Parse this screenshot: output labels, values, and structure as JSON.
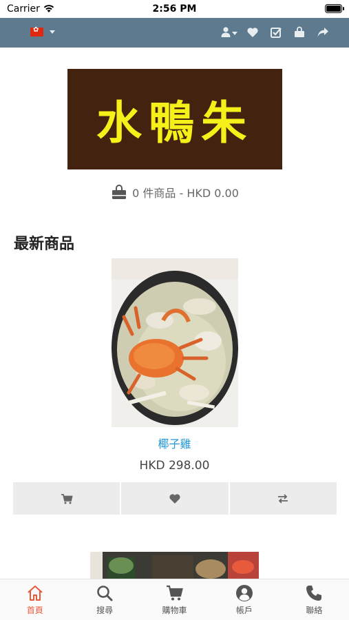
{
  "status_bar": {
    "carrier": "Carrier",
    "time": "2:56 PM"
  },
  "top_bar": {
    "language_flag": "hong-kong-flag-icon",
    "icons": [
      "user-icon",
      "heart-icon",
      "checklist-icon",
      "shopping-bag-icon",
      "share-icon"
    ]
  },
  "logo": {
    "text": "水鴨朱"
  },
  "cart": {
    "summary": "0 件商品 - HKD 0.00"
  },
  "latest": {
    "title": "最新商品",
    "product": {
      "name": "椰子雞",
      "price": "HKD 298.00"
    },
    "actions": [
      "add-to-cart-icon",
      "wishlist-heart-icon",
      "compare-icon"
    ]
  },
  "bottom_nav": {
    "items": [
      {
        "label": "首頁",
        "icon": "home-icon",
        "active": true
      },
      {
        "label": "搜尋",
        "icon": "search-icon",
        "active": false
      },
      {
        "label": "購物車",
        "icon": "cart-icon",
        "active": false
      },
      {
        "label": "帳戶",
        "icon": "account-icon",
        "active": false
      },
      {
        "label": "聯絡",
        "icon": "phone-icon",
        "active": false
      }
    ]
  },
  "colors": {
    "top_bar": "#5e7a8f",
    "accent": "#e8593a",
    "link": "#2196d9",
    "logo_bg": "#43220f",
    "logo_text": "#f5ef1a"
  }
}
